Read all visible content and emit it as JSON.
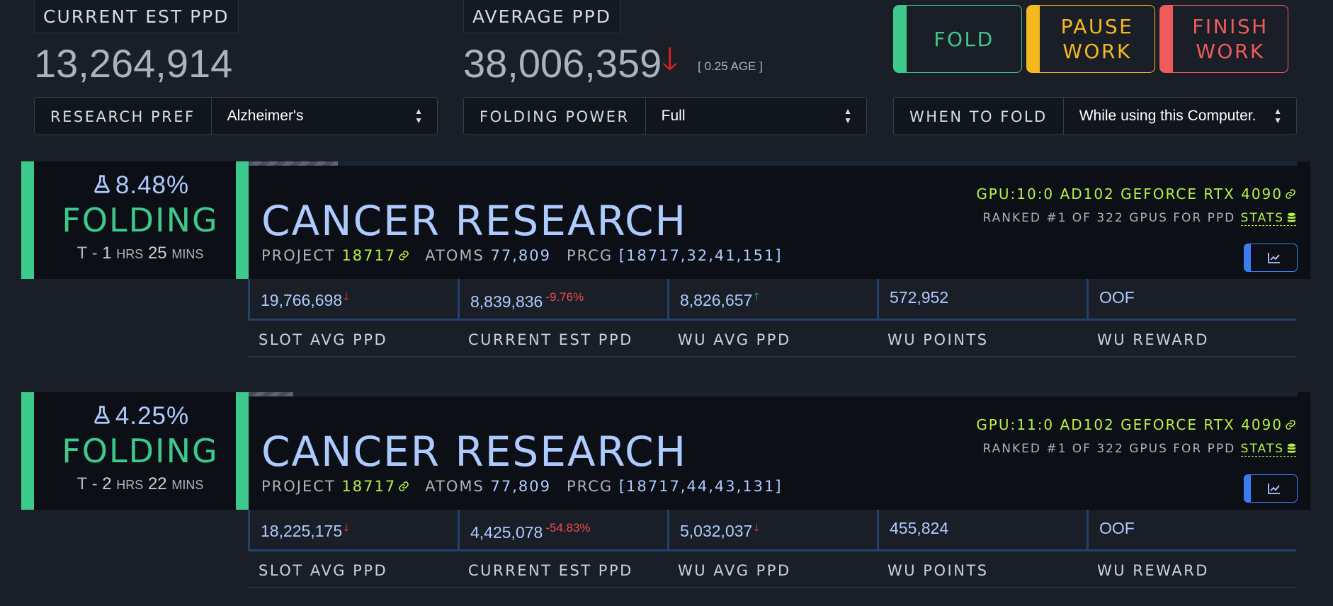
{
  "top": {
    "current_est_ppd_label": "CURRENT EST PPD",
    "current_est_ppd_value": "13,264,914",
    "average_ppd_label": "AVERAGE PPD",
    "average_ppd_value": "38,006,359",
    "average_age": "[ 0.25 AGE ]"
  },
  "controls": {
    "research_pref_label": "RESEARCH PREF",
    "research_pref_value": "Alzheimer's",
    "folding_power_label": "FOLDING POWER",
    "folding_power_value": "Full",
    "when_to_fold_label": "WHEN TO FOLD",
    "when_to_fold_value": "While using this Computer."
  },
  "buttons": {
    "fold": "FOLD",
    "pause_line1": "PAUSE",
    "pause_line2": "WORK",
    "finish_line1": "FINISH",
    "finish_line2": "WORK"
  },
  "colors": {
    "green": "#3ec98c",
    "yellow": "#f4b91e",
    "red": "#ef5b5b",
    "blue": "#aecbff",
    "lime": "#b7f04a"
  },
  "slots": [
    {
      "progress": "8.48%",
      "progress_fraction": 0.0848,
      "state": "FOLDING",
      "eta_prefix": "T - ",
      "eta_hrs": "1",
      "eta_hrs_unit": "HRS",
      "eta_mins": "25",
      "eta_mins_unit": "MINS",
      "research": "CANCER RESEARCH",
      "project_label": "PROJECT",
      "project": "18717",
      "atoms_label": "ATOMS",
      "atoms": "77,809",
      "prcg_label": "PRCG",
      "prcg": "[18717,32,41,151]",
      "gpu": "GPU:10:0 AD102 GEFORCE RTX 4090",
      "rank": "RANKED #1 OF 322 GPUS FOR PPD",
      "stats_label": "STATS",
      "metrics": {
        "slot_avg_ppd": "19,766,698",
        "current_est_ppd": "8,839,836",
        "current_est_change": "-9.76%",
        "wu_avg_ppd": "8,826,657",
        "wu_points": "572,952",
        "wu_reward": "OOF"
      }
    },
    {
      "progress": "4.25%",
      "progress_fraction": 0.0425,
      "state": "FOLDING",
      "eta_prefix": "T - ",
      "eta_hrs": "2",
      "eta_hrs_unit": "HRS",
      "eta_mins": "22",
      "eta_mins_unit": "MINS",
      "research": "CANCER RESEARCH",
      "project_label": "PROJECT",
      "project": "18717",
      "atoms_label": "ATOMS",
      "atoms": "77,809",
      "prcg_label": "PRCG",
      "prcg": "[18717,44,43,131]",
      "gpu": "GPU:11:0 AD102 GEFORCE RTX 4090",
      "rank": "RANKED #1 OF 322 GPUS FOR PPD",
      "stats_label": "STATS",
      "metrics": {
        "slot_avg_ppd": "18,225,175",
        "current_est_ppd": "4,425,078",
        "current_est_change": "-54.83%",
        "wu_avg_ppd": "5,032,037",
        "wu_points": "455,824",
        "wu_reward": "OOF"
      }
    }
  ],
  "metric_labels": {
    "slot_avg_ppd": "SLOT AVG PPD",
    "current_est_ppd": "CURRENT EST PPD",
    "wu_avg_ppd": "WU AVG PPD",
    "wu_points": "WU POINTS",
    "wu_reward": "WU REWARD"
  }
}
